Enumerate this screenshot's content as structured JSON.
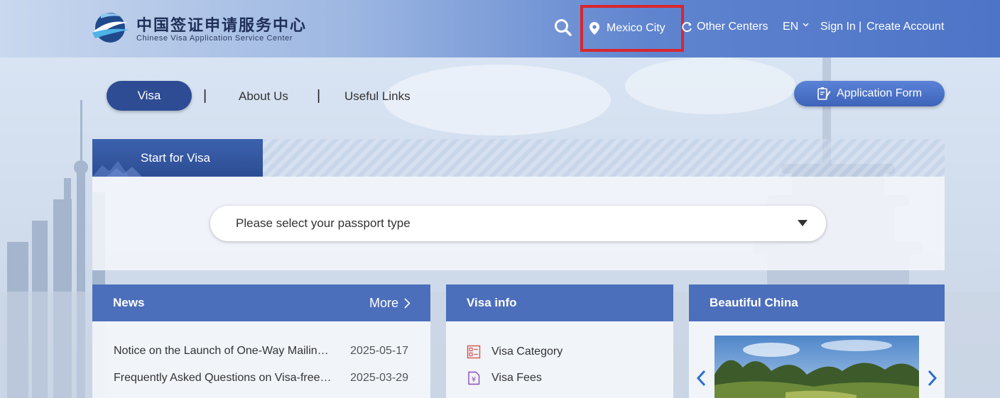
{
  "header": {
    "logo_cn": "中国签证申请服务中心",
    "logo_en": "Chinese Visa Application Service Center",
    "location": "Mexico City",
    "other_centers": "Other Centers",
    "language": "EN",
    "sign_in": "Sign In",
    "separator": "|",
    "create_account": "Create Account"
  },
  "subnav": {
    "visa": "Visa",
    "about": "About Us",
    "links": "Useful Links",
    "separator": "|",
    "application_form": "Application Form"
  },
  "start_panel": {
    "title": "Start for Visa",
    "passport_placeholder": "Please select your passport type"
  },
  "news": {
    "title": "News",
    "more": "More",
    "items": [
      {
        "title": "Notice on the Launch of One-Way Mailing Service",
        "date": "2025-05-17"
      },
      {
        "title": "Frequently Asked Questions on Visa-free Policy",
        "date": "2025-03-29"
      }
    ]
  },
  "visa_info": {
    "title": "Visa info",
    "items": [
      {
        "label": "Visa Category",
        "icon": "list-icon"
      },
      {
        "label": "Visa Fees",
        "icon": "yuan-icon"
      }
    ]
  },
  "beautiful_china": {
    "title": "Beautiful China"
  },
  "colors": {
    "header_blue": "#4d74c7",
    "pill_blue": "#2d4c94",
    "card_head": "#4c6fbc",
    "highlight_red": "#d8262f"
  }
}
